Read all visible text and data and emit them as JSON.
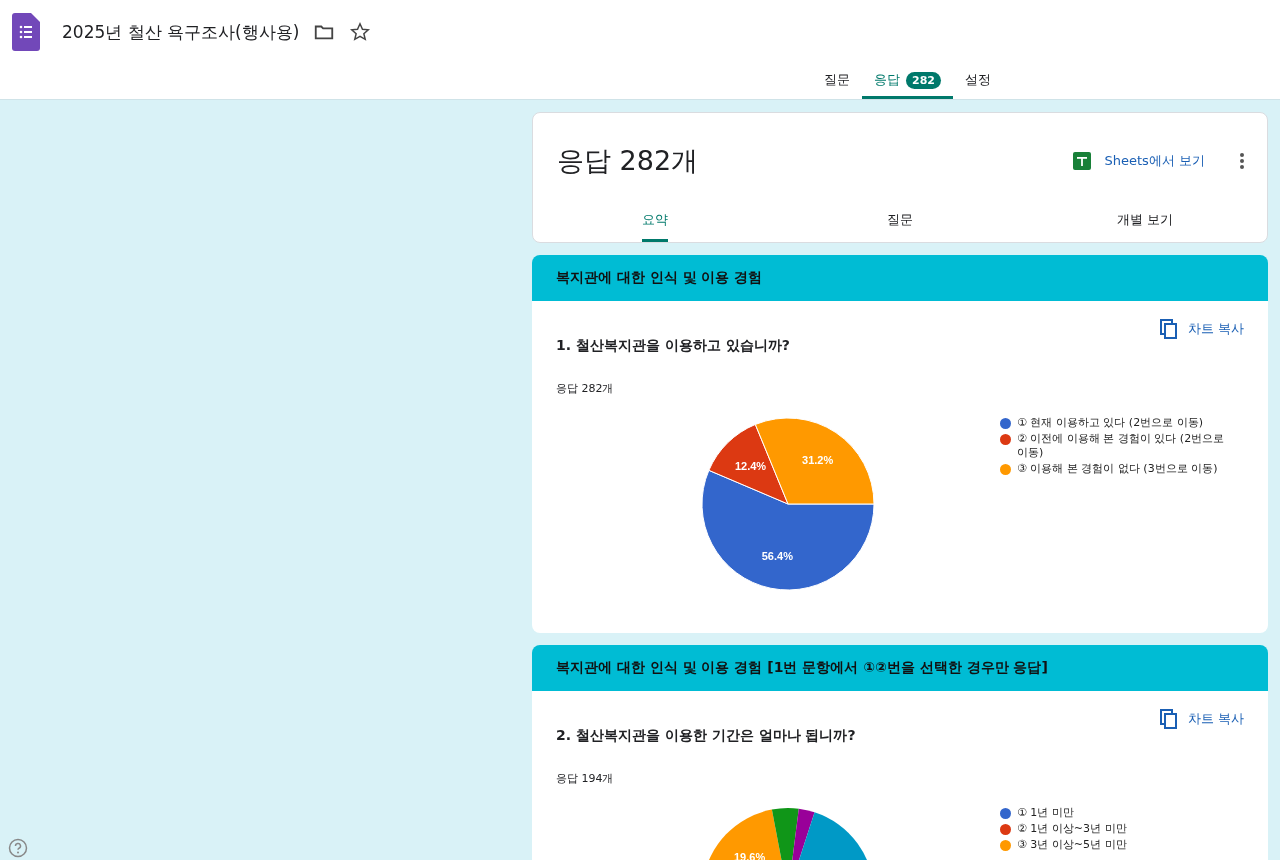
{
  "header": {
    "title": "2025년 철산 욕구조사(행사용)",
    "tabs": [
      {
        "label": "질문",
        "selected": false
      },
      {
        "label": "응답",
        "selected": true,
        "badge": "282"
      },
      {
        "label": "설정",
        "selected": false
      }
    ]
  },
  "summary": {
    "title": "응답 282개",
    "sheets_button": "Sheets에서 보기",
    "tabs": [
      {
        "label": "요약",
        "selected": true
      },
      {
        "label": "질문",
        "selected": false
      },
      {
        "label": "개별 보기",
        "selected": false
      }
    ]
  },
  "sections": [
    {
      "title": "복지관에 대한 인식 및 이용 경험",
      "question": "1. 철산복지관을 이용하고 있습니까?",
      "copy_button": "차트 복사",
      "count": "응답 282개",
      "chart_data": {
        "type": "pie",
        "categories": [
          "① 현재 이용하고 있다 (2번으로 이동)",
          "② 이전에 이용해 본 경험이 있다 (2번으로 이동)",
          "③ 이용해 본 경험이 없다 (3번으로 이동)"
        ],
        "values": [
          56.4,
          12.4,
          31.2
        ],
        "value_labels": [
          "56.4%",
          "12.4%",
          "31.2%"
        ]
      }
    },
    {
      "title": "복지관에 대한 인식 및 이용 경험 [1번 문항에서 ①②번을 선택한 경우만 응답]",
      "question": "2. 철산복지관을 이용한 기간은 얼마나 됩니까?",
      "copy_button": "차트 복사",
      "count": "응답 194개",
      "legend": [
        "① 1년 미만",
        "② 1년 이상~3년 미만",
        "③ 3년 이상~5년 미만"
      ],
      "slice_labels": [
        "19.6%"
      ]
    }
  ]
}
